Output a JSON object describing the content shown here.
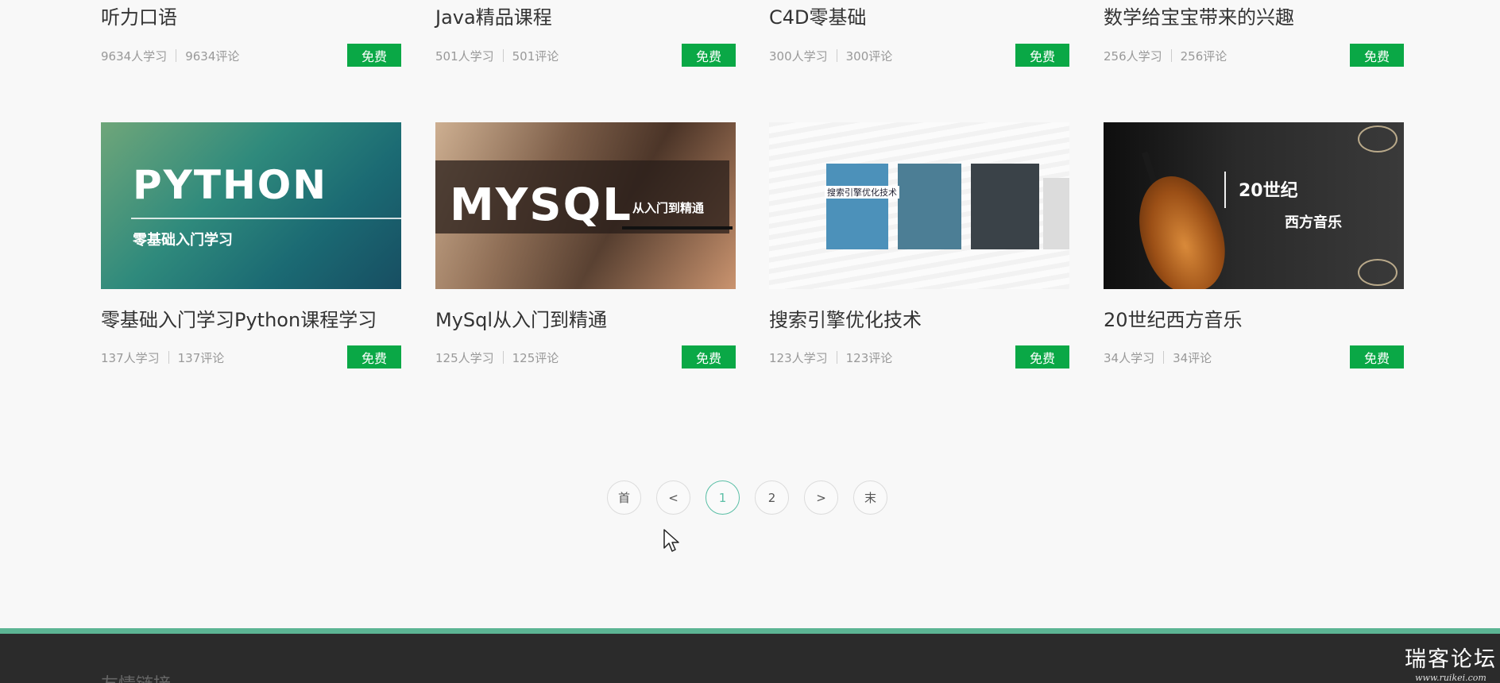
{
  "courses_top": [
    {
      "title": "听力口语",
      "learners": "9634人学习",
      "comments": "9634评论",
      "badge": "免费"
    },
    {
      "title": "Java精品课程",
      "learners": "501人学习",
      "comments": "501评论",
      "badge": "免费"
    },
    {
      "title": "C4D零基础",
      "learners": "300人学习",
      "comments": "300评论",
      "badge": "免费"
    },
    {
      "title": "数学给宝宝带来的兴趣",
      "learners": "256人学习",
      "comments": "256评论",
      "badge": "免费"
    }
  ],
  "courses": [
    {
      "title": "零基础入门学习Python课程学习",
      "learners": "137人学习",
      "comments": "137评论",
      "badge": "免费",
      "thumb": {
        "main": "PYTHON",
        "sub": "零基础入门学习"
      }
    },
    {
      "title": "MySql从入门到精通",
      "learners": "125人学习",
      "comments": "125评论",
      "badge": "免费",
      "thumb": {
        "main": "MYSQL",
        "sub": "从入门到精通"
      }
    },
    {
      "title": "搜索引擎优化技术",
      "learners": "123人学习",
      "comments": "123评论",
      "badge": "免费",
      "thumb": {
        "caption": "搜索引擎优化技术"
      }
    },
    {
      "title": "20世纪西方音乐",
      "learners": "34人学习",
      "comments": "34评论",
      "badge": "免费",
      "thumb": {
        "line1": "20世纪",
        "line2": "西方音乐"
      }
    }
  ],
  "pagination": {
    "first": "首",
    "prev": "<",
    "pages": [
      "1",
      "2"
    ],
    "current": "1",
    "next": ">",
    "last": "末"
  },
  "footer": {
    "links_heading": "友情链接"
  },
  "watermark": {
    "name": "瑞客论坛",
    "url": "www.ruikei.com"
  },
  "colors": {
    "badge": "#0aa846",
    "accent": "#5cb594",
    "footer_bg": "#2b2b2b"
  }
}
